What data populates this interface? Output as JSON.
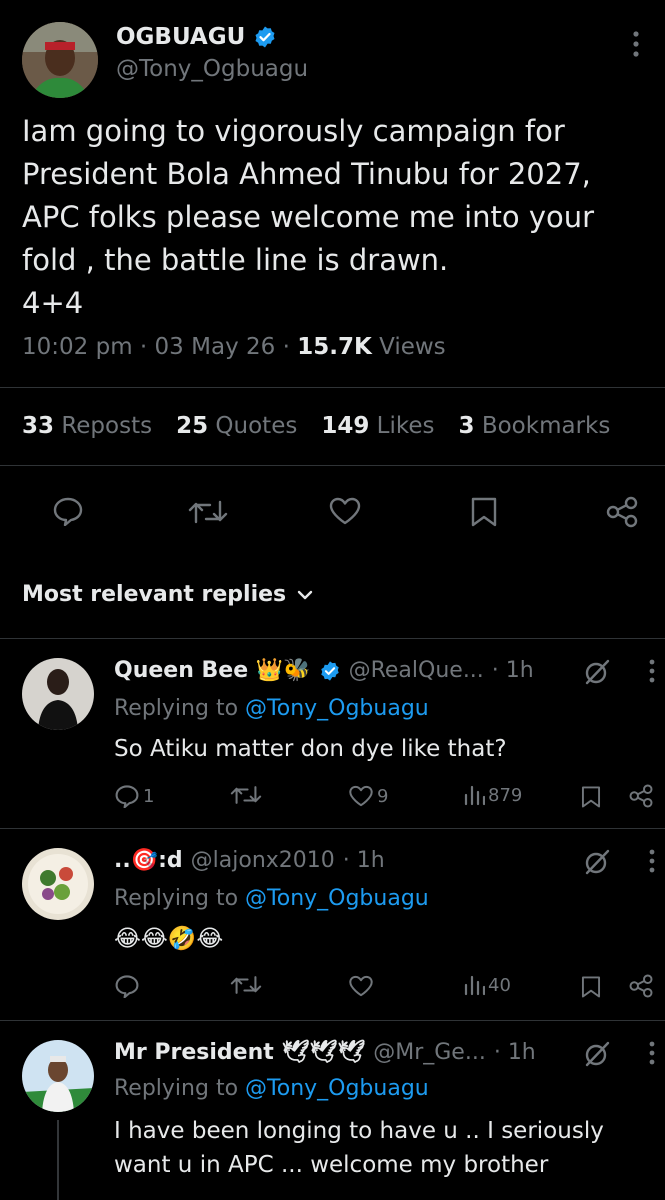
{
  "tweet": {
    "display_name": "OGBUAGU",
    "handle": "@Tony_Ogbuagu",
    "text": "Iam going to vigorously campaign for\nPresident Bola Ahmed Tinubu for 2027,\nAPC folks please welcome me into your\nfold , the battle line is drawn.\n4+4",
    "time": "10:02 pm",
    "date": "03 May 26",
    "views_count": "15.7K",
    "views_label": "Views",
    "verified": true
  },
  "stats": {
    "reposts_count": "33",
    "reposts_label": "Reposts",
    "quotes_count": "25",
    "quotes_label": "Quotes",
    "likes_count": "149",
    "likes_label": "Likes",
    "bookmarks_count": "3",
    "bookmarks_label": "Bookmarks"
  },
  "replies_sort_label": "Most relevant replies",
  "replies": [
    {
      "name": "Queen Bee 👑🐝",
      "handle": "@RealQue...",
      "time": "· 1h",
      "replying_prefix": "Replying to",
      "replying_handle": "@Tony_Ogbuagu",
      "text": "So Atiku matter don dye like that?",
      "reply_count": "1",
      "like_count": "9",
      "view_count": "879"
    },
    {
      "name": "..🎯:d",
      "handle": "@lajonx2010",
      "time": "· 1h",
      "replying_prefix": "Replying to",
      "replying_handle": "@Tony_Ogbuagu",
      "text": "😂😂🤣😂",
      "reply_count": "",
      "like_count": "",
      "view_count": "40"
    },
    {
      "name": "Mr President 🕊🕊🕊",
      "handle": "@Mr_Ge...",
      "time": "· 1h",
      "replying_prefix": "Replying to",
      "replying_handle": "@Tony_Ogbuagu",
      "text": "I have been longing to have u .. I seriously want u in APC ... welcome my brother"
    }
  ],
  "colors": {
    "accent": "#1d9bf0",
    "muted": "#71767b",
    "text": "#e7e9ea",
    "background": "#000000"
  }
}
